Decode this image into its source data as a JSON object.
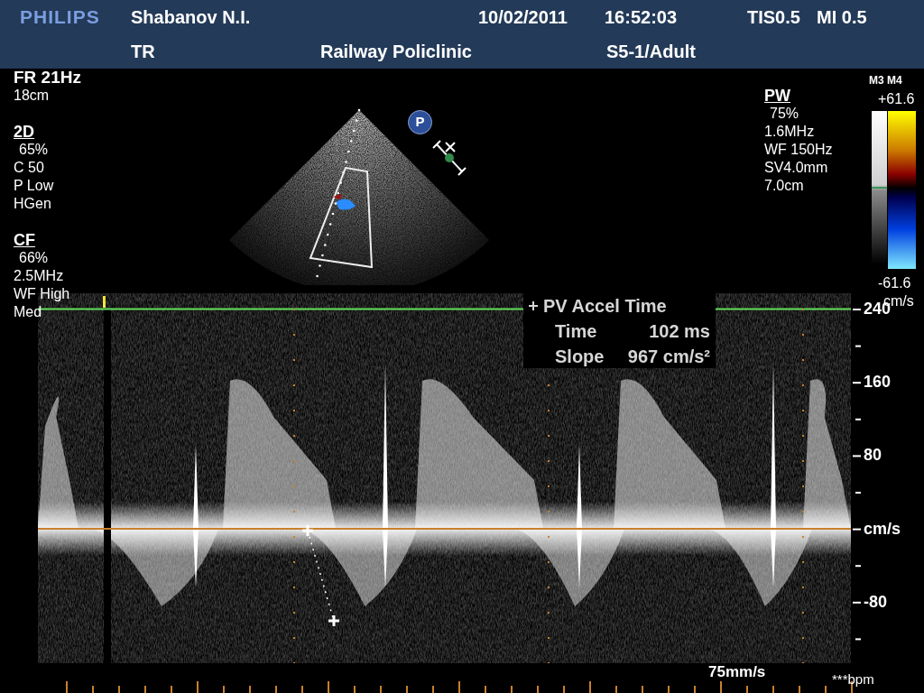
{
  "header": {
    "logo": "PHILIPS",
    "patient_name": "Shabanov N.I.",
    "date": "10/02/2011",
    "time": "16:52:03",
    "tis": "TIS0.5",
    "mi": "MI 0.5",
    "operator": "TR",
    "institution": "Railway Policlinic",
    "probe_preset": "S5-1/Adult"
  },
  "left_panel": [
    {
      "kind": "plain",
      "heading": "FR 21Hz",
      "lines": [
        "18cm"
      ]
    },
    {
      "kind": "mode",
      "heading": "2D",
      "gain": "65%",
      "lines": [
        "C 50",
        "P Low",
        "HGen"
      ]
    },
    {
      "kind": "mode",
      "heading": "CF",
      "gain": "66%",
      "lines": [
        "2.5MHz",
        "WF High",
        "Med"
      ]
    }
  ],
  "sector": {
    "badge": "P"
  },
  "pw_panel": {
    "kind": "mode",
    "heading": "PW",
    "gain": "75%",
    "lines": [
      "1.6MHz",
      "WF 150Hz",
      "SV4.0mm",
      "7.0cm"
    ]
  },
  "color_bar": {
    "label": "M3 M4",
    "max": "+61.6",
    "min": "-61.6",
    "unit": "cm/s"
  },
  "measurement": {
    "title": "PV Accel Time",
    "rows": [
      {
        "label": "Time",
        "value": "102 ms"
      },
      {
        "label": "Slope",
        "value": "967 cm/s²"
      }
    ]
  },
  "scale": {
    "labels": [
      "240",
      "160",
      "80",
      "cm/s",
      "-80"
    ]
  },
  "footer": {
    "sweep_speed": "75mm/s",
    "heart_rate": "***bpm"
  }
}
